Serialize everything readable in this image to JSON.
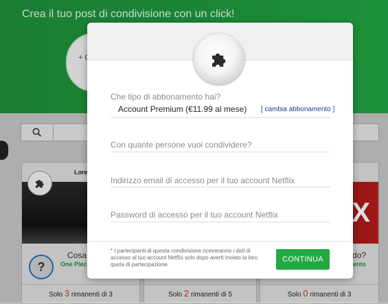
{
  "background": {
    "banner_title": "Crea il tuo post di condivisione con un click!",
    "banner_circle_text": "+ C",
    "cards": [
      {
        "author": "Lore",
        "title": "Cosa c",
        "subtitle": "One Piece",
        "avatar": "?",
        "footer_prefix": "Solo",
        "available": "3",
        "footer_mid": "rimanenti di",
        "total": "3"
      },
      {
        "footer_prefix": "Solo",
        "available": "2",
        "footer_mid": "rimanenti di",
        "total": "5"
      },
      {
        "title": "sido?",
        "subtitle": "ento",
        "image_text": "IX",
        "footer_prefix": "Solo",
        "available": "0",
        "footer_mid": "rimanenti di",
        "total": "3"
      }
    ]
  },
  "modal": {
    "plan_label": "Che tipo di abbonamento hai?",
    "plan_value": "Account Premium (€11.99 al mese)",
    "change_plan_link": "[ cambia abbonamento ]",
    "share_count_placeholder": "Con quante persone vuoi condividere?",
    "email_placeholder": "Indirizzo email di accesso per il tuo account Netflix",
    "password_placeholder": "Password di accesso per il tuo account Netflix",
    "note": "* I partecipanti di questa condivisione riceveranno i dati di accesso al tuo account Netflix solo dopo averti inviato la loro quota di partecipazione.",
    "continue_label": "CONTINUA"
  },
  "colors": {
    "brand_green": "#1f8f3a",
    "button_green": "#22a944",
    "link_blue": "#1a3d8f",
    "count_red": "#d32f2f"
  },
  "icons": {
    "badge": "puzzle-icon",
    "search": "search-icon"
  }
}
